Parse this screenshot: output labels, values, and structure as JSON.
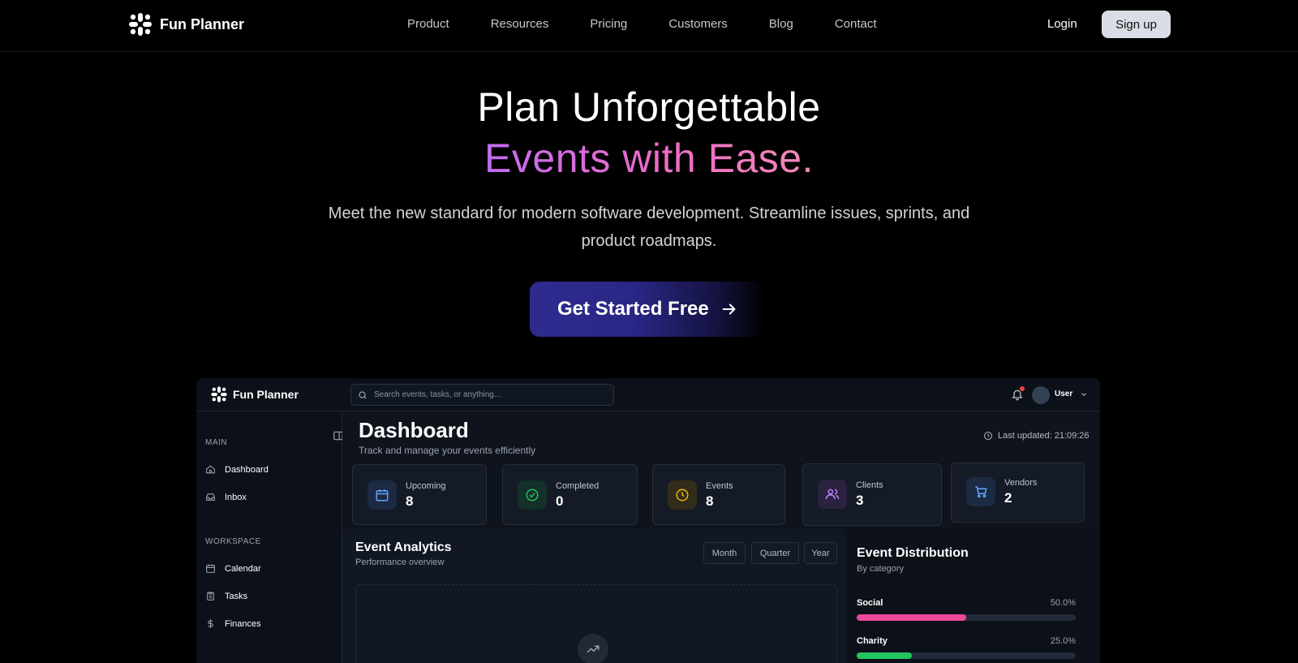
{
  "nav": {
    "brand": "Fun Planner",
    "links": [
      "Product",
      "Resources",
      "Pricing",
      "Customers",
      "Blog",
      "Contact"
    ],
    "login": "Login",
    "signup": "Sign up"
  },
  "hero": {
    "title_line1": "Plan Unforgettable",
    "title_line2": "Events with Ease.",
    "subtitle": "Meet the new standard for modern software development. Streamline issues, sprints, and product roadmaps.",
    "cta": "Get Started Free"
  },
  "dashboard": {
    "brand": "Fun Planner",
    "search_placeholder": "Search events, tasks, or anything...",
    "user": "User",
    "sidebar": {
      "sections": [
        {
          "title": "MAIN",
          "items": [
            {
              "label": "Dashboard",
              "icon": "home-icon"
            },
            {
              "label": "Inbox",
              "icon": "inbox-icon"
            }
          ]
        },
        {
          "title": "WORKSPACE",
          "items": [
            {
              "label": "Calendar",
              "icon": "calendar-icon"
            },
            {
              "label": "Tasks",
              "icon": "clipboard-icon"
            },
            {
              "label": "Finances",
              "icon": "dollar-icon"
            }
          ]
        }
      ]
    },
    "page_title": "Dashboard",
    "page_subtitle": "Track and manage your events efficiently",
    "last_updated": "Last updated: 21:09:26",
    "stats": [
      {
        "label": "Upcoming",
        "value": "8",
        "icon": "calendar-icon",
        "color": "#60a5fa",
        "bg": "#1c2a44"
      },
      {
        "label": "Completed",
        "value": "0",
        "icon": "check-circle-icon",
        "color": "#22c55e",
        "bg": "#14302a"
      },
      {
        "label": "Events",
        "value": "8",
        "icon": "clock-icon",
        "color": "#eab308",
        "bg": "#322d1a"
      },
      {
        "label": "Clients",
        "value": "3",
        "icon": "users-icon",
        "color": "#c084fc",
        "bg": "#2b2240"
      },
      {
        "label": "Vendors",
        "value": "2",
        "icon": "cart-icon",
        "color": "#60a5fa",
        "bg": "#1c2a44"
      }
    ],
    "analytics": {
      "title": "Event Analytics",
      "subtitle": "Performance overview",
      "ranges": [
        "Month",
        "Quarter",
        "Year"
      ]
    },
    "distribution": {
      "title": "Event Distribution",
      "subtitle": "By category",
      "items": [
        {
          "name": "Social",
          "percent_label": "50.0%",
          "fraction": 0.5,
          "color": "#ec4899"
        },
        {
          "name": "Charity",
          "percent_label": "25.0%",
          "fraction": 0.25,
          "color": "#22c55e"
        }
      ]
    }
  }
}
